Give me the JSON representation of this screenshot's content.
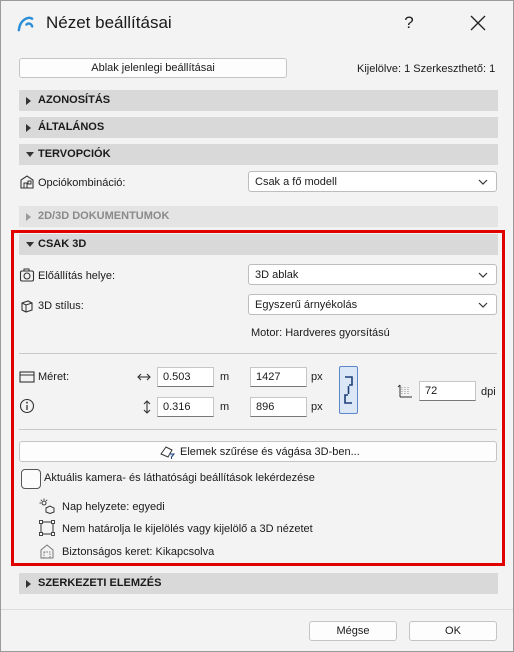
{
  "window": {
    "title": "Nézet beállításai",
    "help_label": "?"
  },
  "top": {
    "current_settings_button": "Ablak jelenlegi beállításai",
    "selection_info": "Kijelölve: 1 Szerkeszthető: 1"
  },
  "sections": {
    "identification": "AZONOSÍTÁS",
    "general": "ÁLTALÁNOS",
    "design_options": "TERVOPCIÓK",
    "docs_2d3d": "2D/3D DOKUMENTUMOK",
    "only_3d": "CSAK 3D",
    "structural_analysis": "SZERKEZETI ELEMZÉS"
  },
  "design_options": {
    "combination_label": "Opciókombináció:",
    "combination_value": "Csak a fő modell"
  },
  "only_3d": {
    "source_label": "Előállítás helye:",
    "source_value": "3D ablak",
    "style_label": "3D stílus:",
    "style_value": "Egyszerű árnyékolás",
    "engine_info": "Motor: Hardveres gyorsítású",
    "size_label": "Méret:",
    "width_value": "0.503",
    "height_value": "0.316",
    "unit_m": "m",
    "width_px": "1427",
    "height_px": "896",
    "unit_px": "px",
    "dpi_value": "72",
    "unit_dpi": "dpi",
    "filter_button": "Elemek szűrése és vágása 3D-ben...",
    "camera_checkbox_label": "Aktuális kamera- és láthatósági beállítások lekérdezése",
    "sun_position": "Nap helyzete: egyedi",
    "selection_limit": "Nem határolja le kijelölés vagy kijelölő a 3D nézetet",
    "safety_box": "Biztonságos keret: Kikapcsolva"
  },
  "footer": {
    "cancel_label": "Mégse",
    "ok_label": "OK"
  },
  "colors": {
    "highlight": "#e00000",
    "section_header": "#d9d9d9",
    "link_accent": "#5b86c8"
  }
}
